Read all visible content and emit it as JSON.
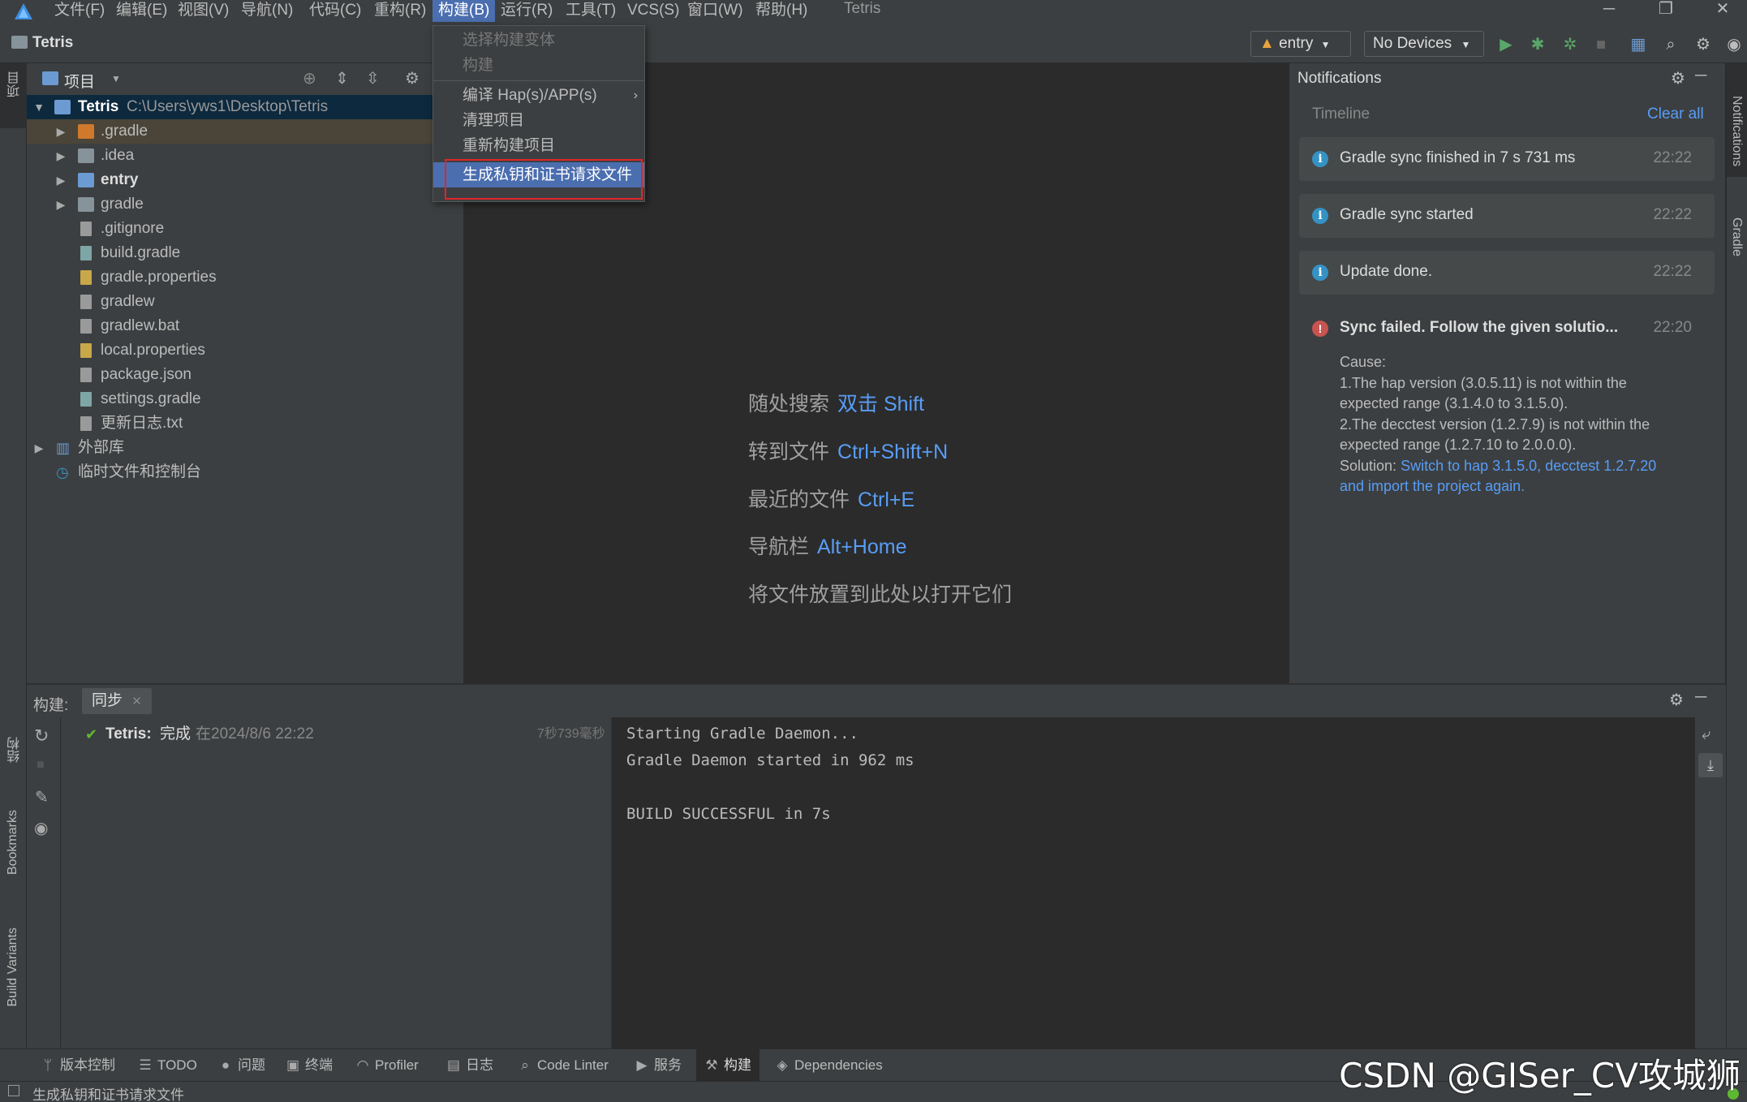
{
  "menubar": {
    "items": [
      "文件(F)",
      "编辑(E)",
      "视图(V)",
      "导航(N)",
      "代码(C)",
      "重构(R)",
      "构建(B)",
      "运行(R)",
      "工具(T)",
      "VCS(S)",
      "窗口(W)",
      "帮助(H)"
    ],
    "window_title": "Tetris",
    "controls": [
      "─",
      "❐",
      "✕"
    ]
  },
  "navbar": {
    "project_name": "Tetris",
    "run_config": "entry",
    "device": "No Devices"
  },
  "build_menu": {
    "items": [
      "选择构建变体",
      "构建",
      "编译 Hap(s)/APP(s)",
      "清理项目",
      "重新构建项目",
      "生成私钥和证书请求文件"
    ]
  },
  "project_panel": {
    "title": "项目",
    "root_name": "Tetris",
    "root_path": "C:\\Users\\yws1\\Desktop\\Tetris",
    "items": [
      ".gradle",
      ".idea",
      "entry",
      "gradle",
      ".gitignore",
      "build.gradle",
      "gradle.properties",
      "gradlew",
      "gradlew.bat",
      "local.properties",
      "package.json",
      "settings.gradle",
      "更新日志.txt"
    ],
    "external_libs": "外部库",
    "scratches": "临时文件和控制台"
  },
  "editor_hints": [
    {
      "text": "随处搜索",
      "key": "双击 Shift"
    },
    {
      "text": "转到文件",
      "key": "Ctrl+Shift+N"
    },
    {
      "text": "最近的文件",
      "key": "Ctrl+E"
    },
    {
      "text": "导航栏",
      "key": "Alt+Home"
    },
    {
      "text": "将文件放置到此处以打开它们",
      "key": ""
    }
  ],
  "notifications": {
    "title": "Notifications",
    "timeline": "Timeline",
    "clear_all": "Clear all",
    "items": [
      {
        "text": "Gradle sync finished in 7 s 731 ms",
        "time": "22:22",
        "type": "info"
      },
      {
        "text": "Gradle sync started",
        "time": "22:22",
        "type": "info"
      },
      {
        "text": "Update done.",
        "time": "22:22",
        "type": "info"
      }
    ],
    "error": {
      "title": "Sync failed. Follow the given solutio...",
      "time": "22:20",
      "cause_label": "Cause:",
      "line1": "1.The hap version (3.0.5.11) is not within the",
      "line2": "expected range (3.1.4.0 to 3.1.5.0).",
      "line3": "2.The decctest version (1.2.7.9) is not within the",
      "line4": "expected range (1.2.7.10 to 2.0.0.0).",
      "solution_label": "Solution:",
      "solution_link1": "Switch to hap 3.1.5.0, decctest 1.2.7.20",
      "solution_link2": "and import the project again."
    }
  },
  "build_panel": {
    "label": "构建:",
    "tab": "同步",
    "task_name": "Tetris:",
    "task_status": "完成",
    "task_time": "在2024/8/6 22:22",
    "task_duration": "7秒739毫秒",
    "console_lines": [
      "Starting Gradle Daemon...",
      "Gradle Daemon started in 962 ms",
      "",
      "BUILD SUCCESSFUL in 7s"
    ]
  },
  "left_strip": {
    "project": "项目",
    "structure": "结构",
    "bookmarks": "Bookmarks",
    "build_variants": "Build Variants"
  },
  "right_strip": {
    "notifications": "Notifications",
    "gradle": "Gradle"
  },
  "tool_tabs": [
    "版本控制",
    "TODO",
    "问题",
    "终端",
    "Profiler",
    "日志",
    "Code Linter",
    "服务",
    "构建",
    "Dependencies"
  ],
  "status_bar": {
    "text": "生成私钥和证书请求文件"
  },
  "watermark": "CSDN @GISer_CV攻城狮",
  "colors": {
    "accent": "#4b6eaf",
    "link": "#589df6",
    "highlight_box": "#e0252a",
    "success": "#5fb832"
  }
}
